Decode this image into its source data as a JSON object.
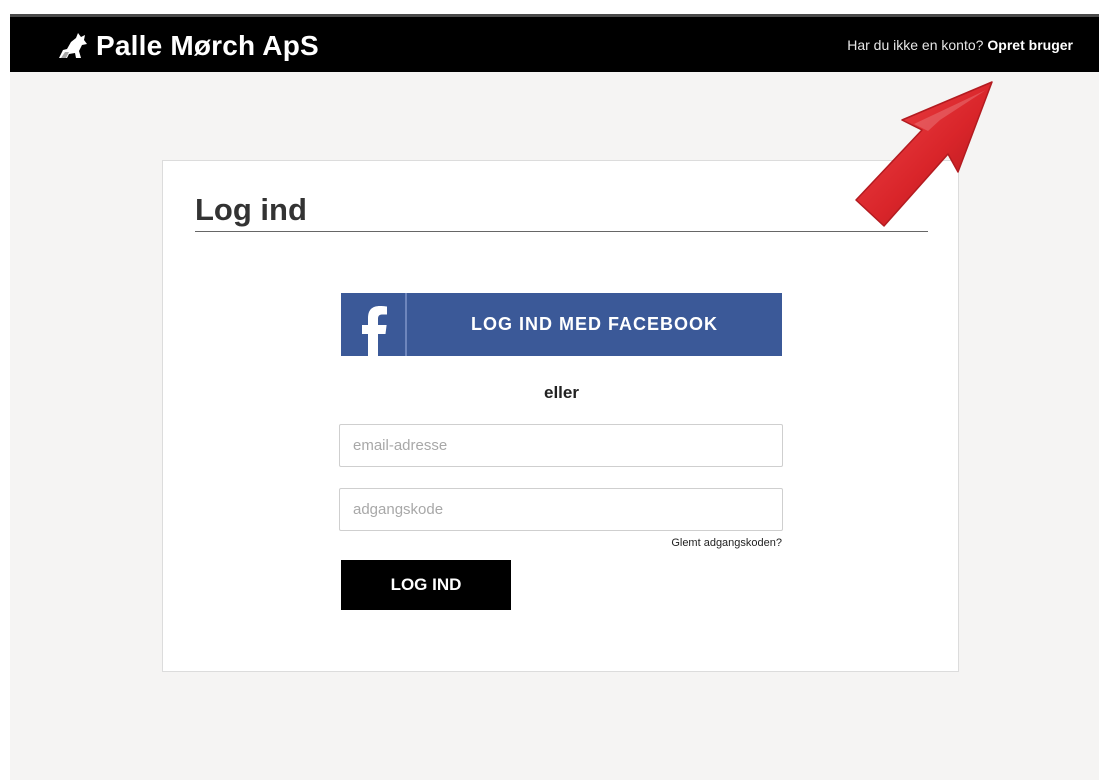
{
  "header": {
    "brand_name": "Palle Mørch ApS",
    "brand_icon": "dog-icon",
    "account_prompt": "Har du ikke en konto?",
    "signup_label": "Opret bruger"
  },
  "login": {
    "title": "Log ind",
    "facebook_button_label": "LOG IND MED FACEBOOK",
    "facebook_icon": "facebook-icon",
    "or_text": "eller",
    "email_placeholder": "email-adresse",
    "email_value": "",
    "password_placeholder": "adgangskode",
    "password_value": "",
    "forgot_password_label": "Glemt adgangskoden?",
    "submit_label": "LOG IND"
  },
  "annotation": {
    "icon": "red-arrow-icon",
    "color": "#d9252a"
  },
  "colors": {
    "topbar": "#000000",
    "page_background": "#f5f4f3",
    "facebook_blue": "#3b5998",
    "button_black": "#000000"
  }
}
